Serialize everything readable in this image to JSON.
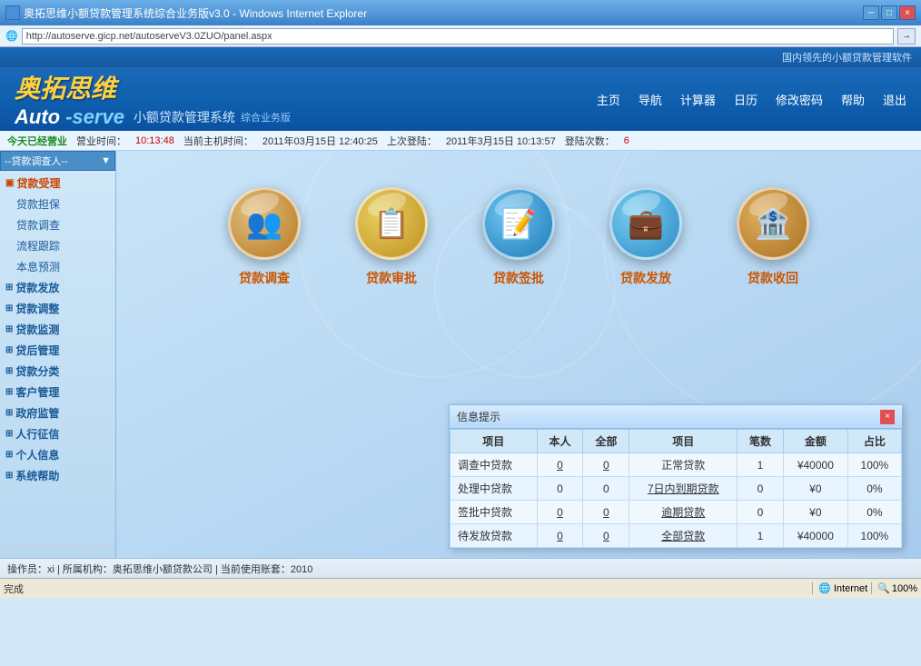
{
  "window": {
    "title": "奥拓思维小额贷款管理系统综合业务版v3.0 - Windows Internet Explorer",
    "address": "http://autoserve.gicp.net/autoserveV3.0ZUO/panel.aspx",
    "close_btn": "×",
    "min_btn": "─",
    "max_btn": "□"
  },
  "header": {
    "top_right": "国内领先的小额贷款管理软件",
    "logo_auto": "Auto",
    "logo_serve": "-serve",
    "logo_subtitle": "小额贷款管理系统",
    "logo_edition": "综合业务版",
    "nav": [
      "主页",
      "导航",
      "计算器",
      "日历",
      "修改密码",
      "帮助",
      "退出"
    ]
  },
  "statusbar": {
    "open_label": "今天已经营业",
    "business_time_label": "营业时间：",
    "business_time": "10:13:48",
    "current_time_label": "当前主机时间：",
    "current_time": "2011年03月15日  12:40:25",
    "last_login_label": "上次登陆：",
    "last_login": "2011年3月15日  10:13:57",
    "login_count_label": "登陆次数：",
    "login_count": "6"
  },
  "sidebar": {
    "dropdown_label": "--贷款调查人--",
    "groups": [
      {
        "label": "贷款受理",
        "active": true,
        "expanded": true,
        "items": [
          "贷款担保",
          "贷款调查",
          "流程跟踪",
          "本息预测"
        ]
      },
      {
        "label": "贷款发放",
        "active": false,
        "expanded": false,
        "items": []
      },
      {
        "label": "贷款调整",
        "active": false,
        "expanded": false,
        "items": []
      },
      {
        "label": "贷款监测",
        "active": false,
        "expanded": false,
        "items": []
      },
      {
        "label": "贷后管理",
        "active": false,
        "expanded": false,
        "items": []
      },
      {
        "label": "贷款分类",
        "active": false,
        "expanded": false,
        "items": []
      },
      {
        "label": "客户管理",
        "active": false,
        "expanded": false,
        "items": []
      },
      {
        "label": "政府监管",
        "active": false,
        "expanded": false,
        "items": []
      },
      {
        "label": "人行征信",
        "active": false,
        "expanded": false,
        "items": []
      },
      {
        "label": "个人信息",
        "active": false,
        "expanded": false,
        "items": []
      },
      {
        "label": "系统帮助",
        "active": false,
        "expanded": false,
        "items": []
      }
    ]
  },
  "features": [
    {
      "label": "贷款调查",
      "icon": "👥"
    },
    {
      "label": "贷款审批",
      "icon": "📋"
    },
    {
      "label": "贷款签批",
      "icon": "📝"
    },
    {
      "label": "贷款发放",
      "icon": "💼"
    },
    {
      "label": "贷款收回",
      "icon": "🏦"
    }
  ],
  "info_panel": {
    "title": "信息提示",
    "col_headers": [
      "项目",
      "本人",
      "全部",
      "项目",
      "笔数",
      "金额",
      "占比"
    ],
    "rows": [
      {
        "item1": "调查中贷款",
        "self1": "0",
        "all1": "0",
        "item2": "正常贷款",
        "count": "1",
        "amount": "¥40000",
        "percent": "100%"
      },
      {
        "item1": "处理中贷款",
        "self1": "0",
        "all1": "0",
        "item2": "7日内到期贷款",
        "count": "0",
        "amount": "¥0",
        "percent": "0%"
      },
      {
        "item1": "签批中贷款",
        "self1": "0",
        "all1": "0",
        "item2": "逾期贷款",
        "count": "0",
        "amount": "¥0",
        "percent": "0%"
      },
      {
        "item1": "待发放贷款",
        "self1": "0",
        "all1": "0",
        "item2": "全部贷款",
        "count": "1",
        "amount": "¥40000",
        "percent": "100%"
      }
    ]
  },
  "bottom_status": {
    "text": "操作员：xi | 所属机构：奥拓思维小额贷款公司 | 当前使用账套：2010"
  },
  "ie_bottom": {
    "status": "完成",
    "zone": "Internet",
    "zoom": "100%"
  }
}
